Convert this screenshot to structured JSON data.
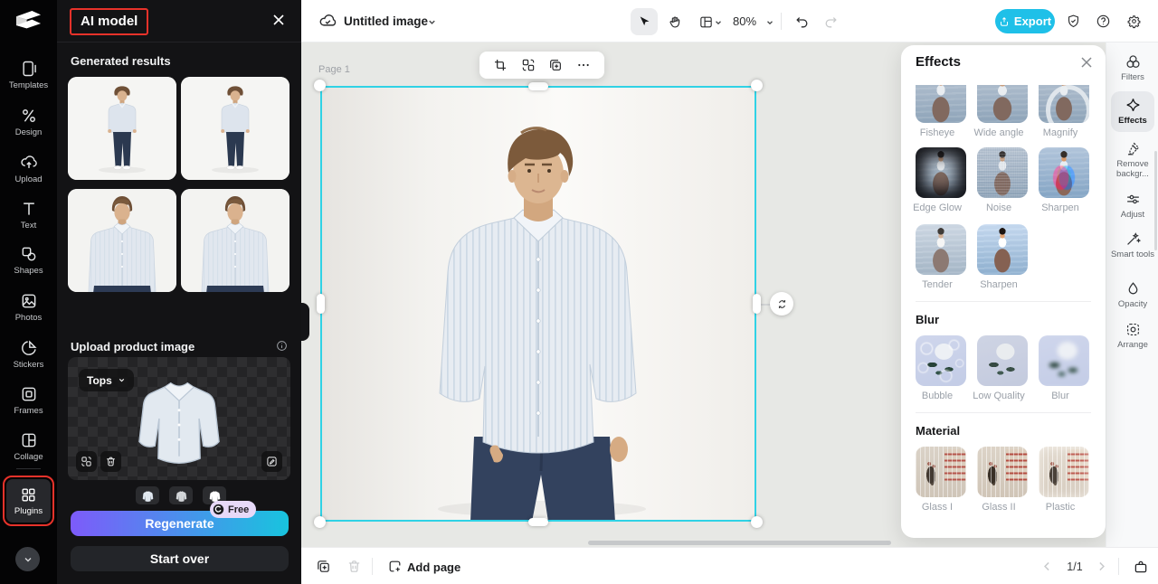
{
  "left_rail": {
    "items": [
      {
        "label": "Templates"
      },
      {
        "label": "Design"
      },
      {
        "label": "Upload"
      },
      {
        "label": "Text"
      },
      {
        "label": "Shapes"
      },
      {
        "label": "Photos"
      },
      {
        "label": "Stickers"
      },
      {
        "label": "Frames"
      },
      {
        "label": "Collage"
      },
      {
        "label": "Plugins"
      }
    ]
  },
  "ai_panel": {
    "title": "AI model",
    "generated_heading": "Generated results",
    "upload_heading": "Upload product image",
    "category": "Tops",
    "free_badge": "Free",
    "regenerate": "Regenerate",
    "start_over": "Start over"
  },
  "topbar": {
    "title": "Untitled image",
    "zoom": "80%",
    "export": "Export"
  },
  "canvas": {
    "page_label": "Page 1"
  },
  "effects_panel": {
    "title": "Effects",
    "sections": [
      {
        "heading": "",
        "items": [
          {
            "label": "Fisheye"
          },
          {
            "label": "Wide angle"
          },
          {
            "label": "Magnify"
          },
          {
            "label": "Edge Glow"
          },
          {
            "label": "Noise"
          },
          {
            "label": "Sharpen"
          },
          {
            "label": "Tender"
          },
          {
            "label": "Sharpen"
          }
        ]
      },
      {
        "heading": "Blur",
        "items": [
          {
            "label": "Bubble"
          },
          {
            "label": "Low Quality"
          },
          {
            "label": "Blur"
          }
        ]
      },
      {
        "heading": "Material",
        "items": [
          {
            "label": "Glass I"
          },
          {
            "label": "Glass II"
          },
          {
            "label": "Plastic"
          }
        ]
      }
    ]
  },
  "right_rail": {
    "items": [
      {
        "label": "Filters"
      },
      {
        "label": "Effects"
      },
      {
        "label": "Remove backgr..."
      },
      {
        "label": "Adjust"
      },
      {
        "label": "Smart tools"
      },
      {
        "label": "Opacity"
      },
      {
        "label": "Arrange"
      }
    ]
  },
  "bottom_bar": {
    "add_page": "Add page",
    "pagination": "1/1"
  },
  "colors": {
    "selection_cyan": "#30d2e5",
    "accent_cyan": "#1fc0e8",
    "annotation_red": "#e8322a",
    "gradient_start": "#7d5bfa",
    "gradient_end": "#18c4de"
  }
}
